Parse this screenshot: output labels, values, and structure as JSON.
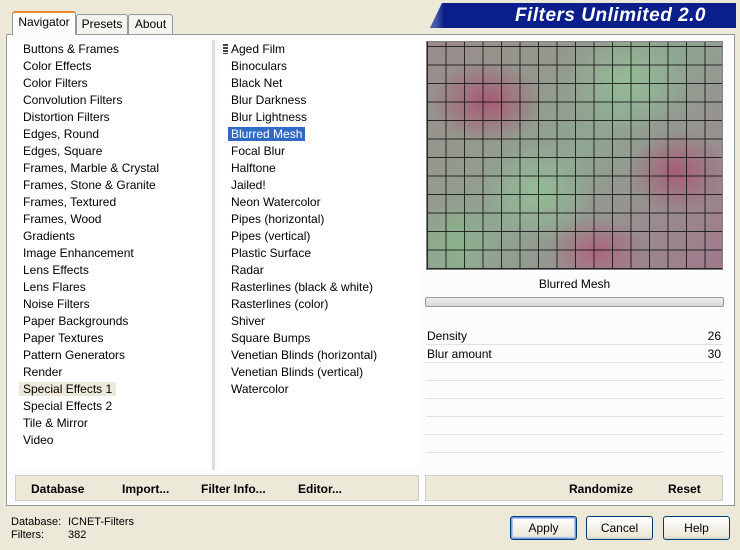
{
  "banner": {
    "title": "Filters Unlimited 2.0"
  },
  "tabs": [
    {
      "label": "Navigator",
      "active": true
    },
    {
      "label": "Presets",
      "active": false
    },
    {
      "label": "About",
      "active": false
    }
  ],
  "categories": {
    "selected_index": 20,
    "items": [
      "Buttons & Frames",
      "Color Effects",
      "Color Filters",
      "Convolution Filters",
      "Distortion Filters",
      "Edges, Round",
      "Edges, Square",
      "Frames, Marble & Crystal",
      "Frames, Stone & Granite",
      "Frames, Textured",
      "Frames, Wood",
      "Gradients",
      "Image Enhancement",
      "Lens Effects",
      "Lens Flares",
      "Noise Filters",
      "Paper Backgrounds",
      "Paper Textures",
      "Pattern Generators",
      "Render",
      "Special Effects 1",
      "Special Effects 2",
      "Tile & Mirror",
      "Video"
    ]
  },
  "filters": {
    "selected_index": 5,
    "items": [
      "Aged Film",
      "Binoculars",
      "Black Net",
      "Blur Darkness",
      "Blur Lightness",
      "Blurred Mesh",
      "Focal Blur",
      "Halftone",
      "Jailed!",
      "Neon Watercolor",
      "Pipes (horizontal)",
      "Pipes (vertical)",
      "Plastic Surface",
      "Radar",
      "Rasterlines (black & white)",
      "Rasterlines (color)",
      "Shiver",
      "Square Bumps",
      "Venetian Blinds (horizontal)",
      "Venetian Blinds (vertical)",
      "Watercolor"
    ]
  },
  "preview": {
    "caption": "Blurred Mesh"
  },
  "params": [
    {
      "label": "Density",
      "value": "26"
    },
    {
      "label": "Blur amount",
      "value": "30"
    }
  ],
  "toolbar": {
    "database": "Database",
    "import": "Import...",
    "filter_info": "Filter Info...",
    "editor": "Editor...",
    "randomize": "Randomize",
    "reset": "Reset"
  },
  "status": {
    "database_label": "Database:",
    "database_value": "ICNET-Filters",
    "filters_label": "Filters:",
    "filters_value": "382"
  },
  "buttons": {
    "apply": "Apply",
    "cancel": "Cancel",
    "help": "Help"
  }
}
